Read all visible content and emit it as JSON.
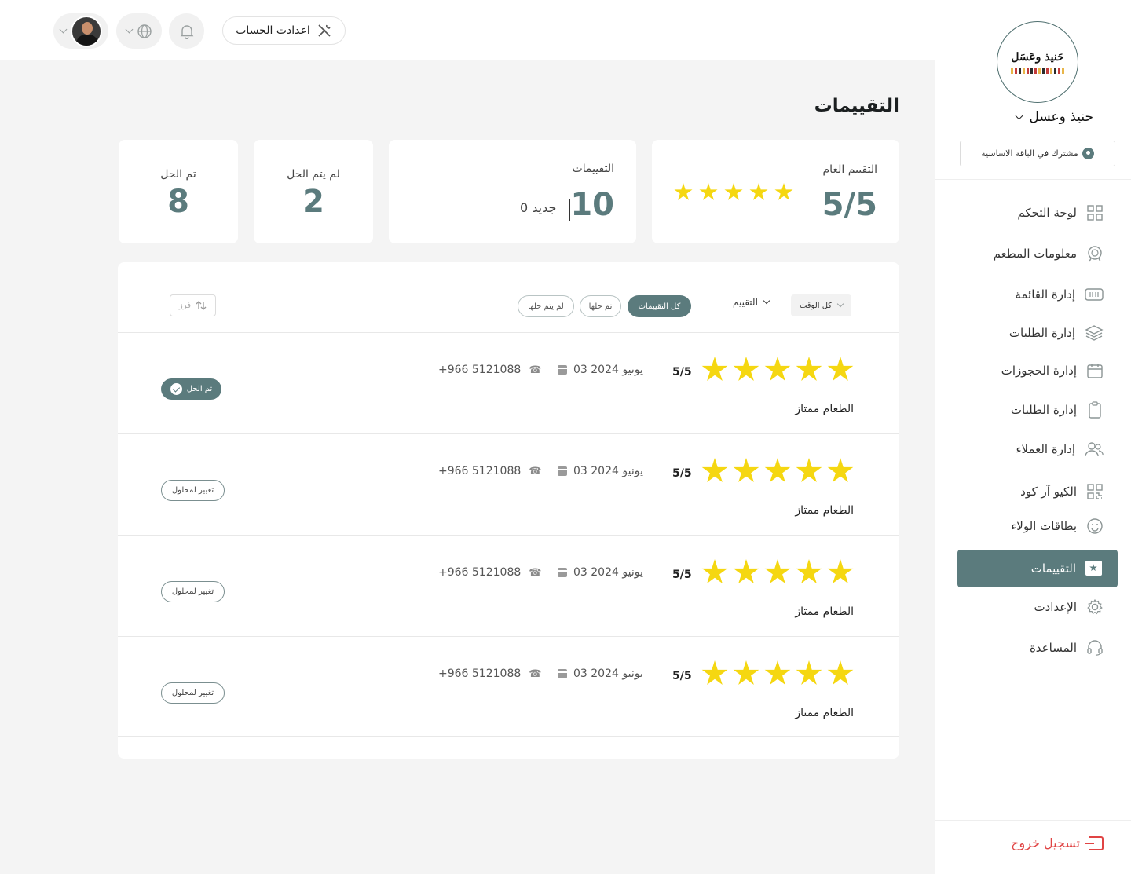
{
  "topbar": {
    "account_settings_label": "اعدادت الحساب"
  },
  "page": {
    "title": "التقييمات"
  },
  "stats": {
    "overall_label": "التقييم العام",
    "overall_value": "5/5",
    "overall_stars": 5,
    "reviews_label": "التقييمات",
    "reviews_count": "10",
    "reviews_new": "0 جديد",
    "unresolved_label": "لم يتم الحل",
    "unresolved_count": "2",
    "resolved_label": "تم الحل",
    "resolved_count": "8"
  },
  "filters": {
    "time_label": "كل الوقت",
    "rating_label": "التقييم",
    "tab_all": "كل التقييمات",
    "tab_resolved": "تم حلها",
    "tab_unresolved": "لم يتم حلها",
    "sort_label": "فرز"
  },
  "reviews": [
    {
      "stars": 5,
      "score": "5/5",
      "date": "03 يونيو 2024",
      "phone": "+966 5121088",
      "comment": "الطعام ممتاز",
      "status": "تم الحل"
    },
    {
      "stars": 5,
      "score": "5/5",
      "date": "03 يونيو 2024",
      "phone": "+966 5121088",
      "comment": "الطعام ممتاز",
      "status": "تغيير لمحلول"
    },
    {
      "stars": 5,
      "score": "5/5",
      "date": "03 يونيو 2024",
      "phone": "+966 5121088",
      "comment": "الطعام ممتاز",
      "status": "تغيير لمحلول"
    },
    {
      "stars": 5,
      "score": "5/5",
      "date": "03 يونيو 2024",
      "phone": "+966 5121088",
      "comment": "الطعام ممتاز",
      "status": "تغيير لمحلول"
    }
  ],
  "sidebar": {
    "logo_text": "حَنيذ وعَسَل",
    "brand_name": "حنيذ وعسل",
    "plan": "مشترك في الباقة الاساسية",
    "items": [
      {
        "label": "لوحة التحكم",
        "icon": "grid-icon"
      },
      {
        "label": "معلومات المطعم",
        "icon": "restaurant-icon"
      },
      {
        "label": "إدارة القائمة",
        "icon": "menu-icon"
      },
      {
        "label": "إدارة الطلبات",
        "icon": "layers-icon"
      },
      {
        "label": "إدارة الحجوزات",
        "icon": "calendar-icon"
      },
      {
        "label": "إدارة الطلبات",
        "icon": "clipboard-icon"
      },
      {
        "label": "إدارة العملاء",
        "icon": "users-icon"
      },
      {
        "label": "الكيو آر كود",
        "icon": "qr-icon"
      },
      {
        "label": "بطاقات الولاء",
        "icon": "smile-icon"
      },
      {
        "label": "التقييمات",
        "icon": "star-flag-icon"
      },
      {
        "label": "الإعدادت",
        "icon": "gear-icon"
      },
      {
        "label": "المساعدة",
        "icon": "headset-icon"
      }
    ],
    "logout_label": "تسجيل خروج"
  },
  "colors": {
    "accent": "#5b7b7d",
    "star": "#f5d711",
    "logout": "#e04444",
    "background": "#f4f4f4"
  }
}
